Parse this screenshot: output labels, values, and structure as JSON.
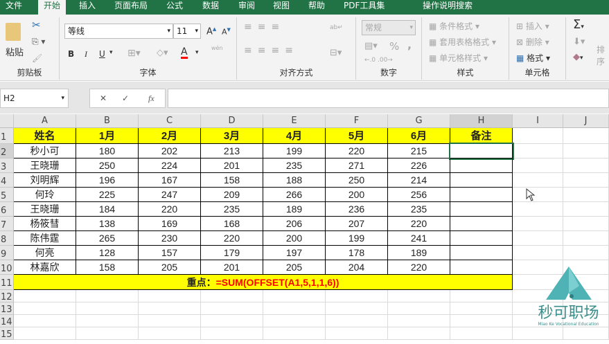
{
  "tabs": [
    "文件",
    "开始",
    "插入",
    "页面布局",
    "公式",
    "数据",
    "审阅",
    "视图",
    "帮助",
    "PDF工具集",
    "操作说明搜索"
  ],
  "active_tab": "开始",
  "ribbon": {
    "clipboard": {
      "paste": "粘贴",
      "label": "剪贴板"
    },
    "font": {
      "name": "等线",
      "size": "11",
      "bold": "B",
      "italic": "I",
      "underline": "U",
      "phonetic": "wén",
      "label": "字体",
      "font_color": "#ff0000"
    },
    "align": {
      "label": "对齐方式"
    },
    "number": {
      "format": "常规",
      "percent": "%",
      "comma": ",",
      "label": "数字"
    },
    "styles": {
      "conditional": "条件格式",
      "table": "套用表格格式",
      "cell": "单元格样式",
      "label": "样式"
    },
    "cells": {
      "insert": "插入",
      "delete": "删除",
      "format": "格式",
      "label": "单元格"
    },
    "editing": {
      "sort": "排序"
    }
  },
  "formula_bar": {
    "name_box": "H2",
    "cancel": "✕",
    "enter": "✓",
    "fx": "fx",
    "value": ""
  },
  "columns": [
    "A",
    "B",
    "C",
    "D",
    "E",
    "F",
    "G",
    "H",
    "I",
    "J"
  ],
  "rows": [
    "1",
    "2",
    "3",
    "4",
    "5",
    "6",
    "7",
    "8",
    "9",
    "10",
    "11",
    "12",
    "13",
    "14",
    "15"
  ],
  "table": {
    "headers": [
      "姓名",
      "1月",
      "2月",
      "3月",
      "4月",
      "5月",
      "6月",
      "备注"
    ],
    "data": [
      [
        "秒小可",
        "180",
        "202",
        "213",
        "199",
        "220",
        "215",
        ""
      ],
      [
        "王晓珊",
        "250",
        "224",
        "201",
        "235",
        "271",
        "226",
        ""
      ],
      [
        "刘明辉",
        "196",
        "167",
        "158",
        "188",
        "250",
        "214",
        ""
      ],
      [
        "何玲",
        "225",
        "247",
        "209",
        "266",
        "200",
        "256",
        ""
      ],
      [
        "王晓珊",
        "184",
        "220",
        "235",
        "189",
        "236",
        "235",
        ""
      ],
      [
        "杨筱彗",
        "138",
        "169",
        "168",
        "206",
        "207",
        "220",
        ""
      ],
      [
        "陈伟霆",
        "265",
        "230",
        "220",
        "200",
        "199",
        "241",
        ""
      ],
      [
        "何亮",
        "128",
        "157",
        "179",
        "197",
        "178",
        "189",
        ""
      ],
      [
        "林嘉欣",
        "158",
        "205",
        "201",
        "205",
        "204",
        "220",
        ""
      ]
    ],
    "note_label": "重点：",
    "note_formula": "=SUM(OFFSET(A1,5,1,1,6))"
  },
  "logo": {
    "name": "秒可职场",
    "tagline": "Miao Ke Vocational Education"
  }
}
